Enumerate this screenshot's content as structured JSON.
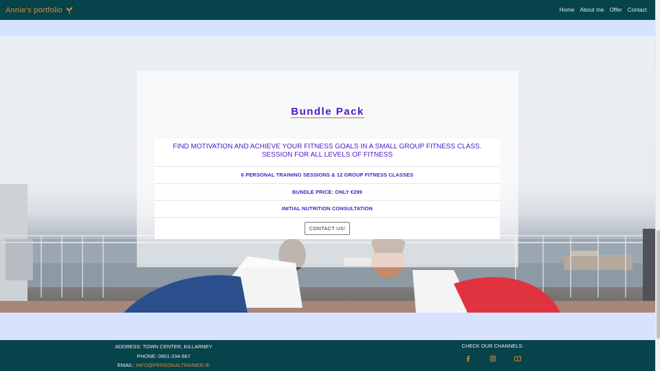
{
  "navbar": {
    "brand": "Annie's portfolio",
    "brand_icon": "sprout-icon",
    "links": [
      "Home",
      "About me",
      "Offer",
      "Contact"
    ]
  },
  "offer": {
    "title": "Bundle Pack",
    "intro": "FIND MOTIVATION AND ACHIEVE YOUR FITNESS GOALS IN A SMALL GROUP FITNESS CLASS. SESSION FOR ALL LEVELS OF FITNESS",
    "items": [
      "6 PERSONAL TRAINING SESSIONS & 12 GROUP FITNESS CLASSES",
      "BUNDLE PRICE: ONLY €299",
      "INITIAL NUTRITION CONSULTATION"
    ],
    "cta": "CONTACT US!"
  },
  "footer": {
    "address": "ADDRESS: TOWN CENTER, KILLARNEY",
    "phone": "PHONE: 0851-234-567",
    "email_label": "EMAIL:",
    "email": "INFO@PERSONALTRAINER.IE",
    "channels_label": "CHECK OUR CHANNELS:",
    "channels": [
      "facebook-icon",
      "instagram-icon",
      "youtube-icon"
    ]
  },
  "colors": {
    "navbar_bg": "#06434a",
    "accent_orange": "#d98a3e",
    "offer_text": "#4a19c6",
    "page_bg": "#d7e2fe"
  }
}
